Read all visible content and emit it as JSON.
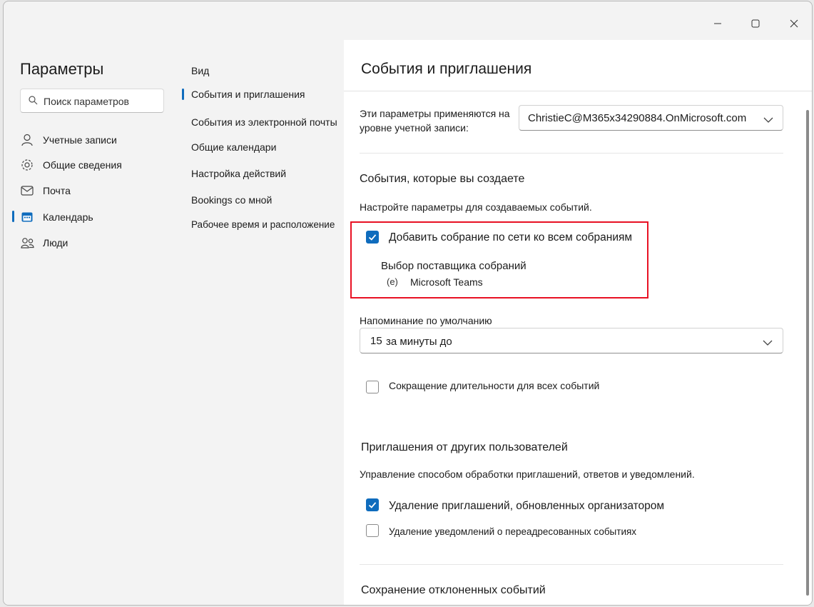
{
  "window": {
    "controls": [
      "minimize-icon",
      "maximize-icon",
      "close-icon"
    ]
  },
  "nav": {
    "title": "Параметры",
    "search_placeholder": "Поиск параметров",
    "items": [
      {
        "label": "Учетные записи",
        "icon": "person-icon"
      },
      {
        "label": "Общие сведения",
        "icon": "gear-icon"
      },
      {
        "label": "Почта",
        "icon": "mail-icon"
      },
      {
        "label": "Календарь",
        "icon": "calendar-icon",
        "selected": true
      },
      {
        "label": "Люди",
        "icon": "people-icon"
      }
    ]
  },
  "subnav": {
    "items": [
      {
        "label": "Вид"
      },
      {
        "label": "События и приглашения",
        "selected": true
      },
      {
        "label": "События из электронной почты"
      },
      {
        "label": "Общие календари"
      },
      {
        "label": "Настройка действий"
      },
      {
        "label": "Bookings со мной"
      },
      {
        "label": "Рабочее время и расположение"
      }
    ]
  },
  "content": {
    "title": "События и приглашения",
    "account": {
      "label": "Эти параметры применяются на уровне учетной записи:",
      "value": "ChristieC@M365x34290884.OnMicrosoft.com"
    },
    "created": {
      "heading": "События, которые вы создаете",
      "description": "Настройте параметры для создаваемых событий.",
      "online_meeting_label": "Добавить собрание по сети ко всем собраниям",
      "online_meeting_checked": true,
      "provider_label": "Выбор поставщика собраний",
      "provider_value": "Microsoft Teams",
      "provider_radio_glyph": "(e)",
      "reminder_label": "Напоминание по умолчанию",
      "reminder_value": "15",
      "reminder_suffix": "за минуты до",
      "shorten_label": "Сокращение длительности для всех событий",
      "shorten_checked": false
    },
    "invites": {
      "heading": "Приглашения от других пользователей",
      "description": "Управление способом обработки приглашений, ответов и уведомлений.",
      "delete_updated_label": "Удаление приглашений, обновленных организатором",
      "delete_updated_checked": true,
      "delete_forward_label": "Удаление уведомлений о переадресованных событиях",
      "delete_forward_checked": false
    },
    "declined": {
      "heading": "Сохранение отклоненных событий"
    }
  },
  "colors": {
    "accent": "#0f6cbd",
    "highlight_box": "#e81123"
  }
}
